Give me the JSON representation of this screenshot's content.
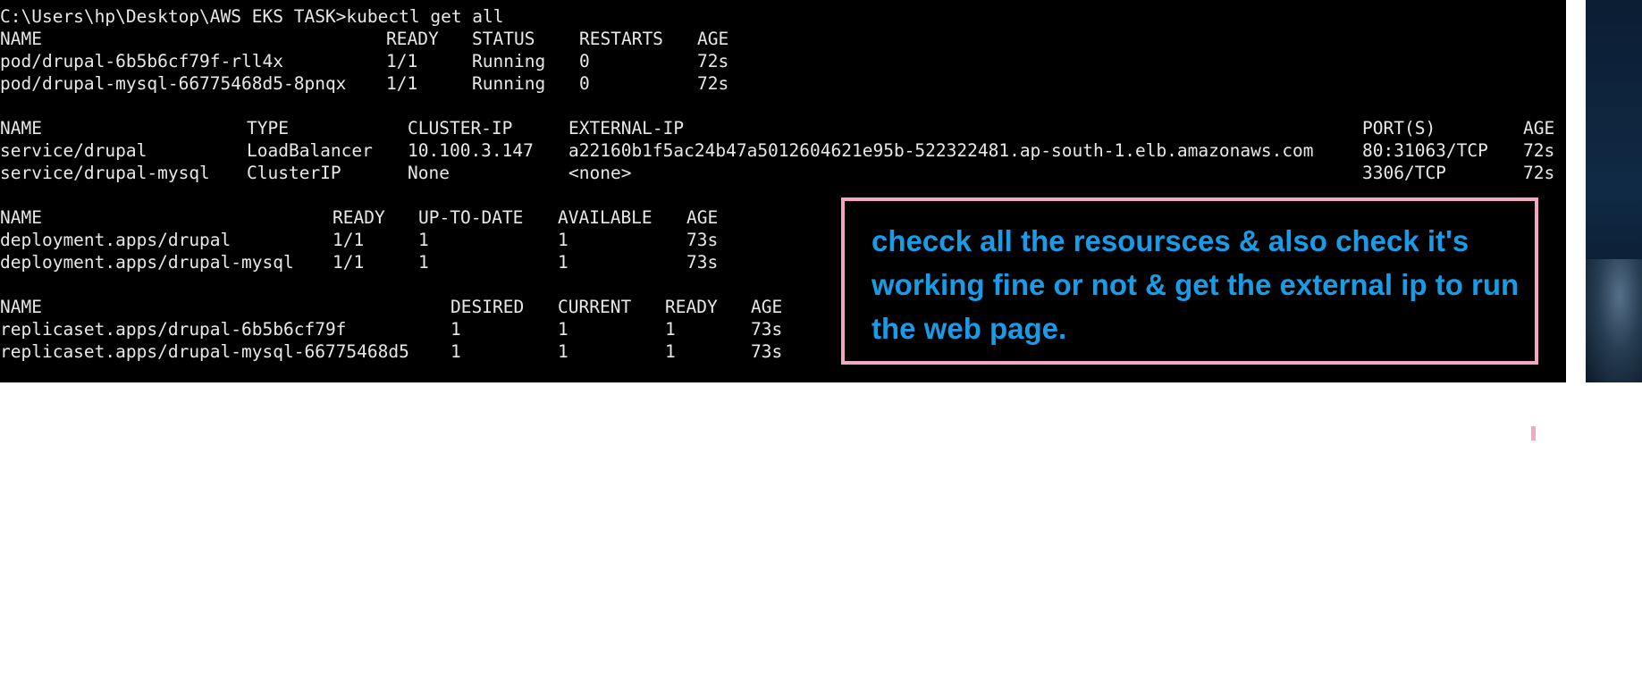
{
  "terminal": {
    "prompt": "C:\\Users\\hp\\Desktop\\AWS EKS TASK>kubectl get all",
    "pods": {
      "headers": [
        "NAME",
        "READY",
        "STATUS",
        "RESTARTS",
        "AGE"
      ],
      "rows": [
        [
          "pod/drupal-6b5b6cf79f-rll4x",
          "1/1",
          "Running",
          "0",
          "72s"
        ],
        [
          "pod/drupal-mysql-66775468d5-8pnqx",
          "1/1",
          "Running",
          "0",
          "72s"
        ]
      ]
    },
    "services": {
      "headers": [
        "NAME",
        "TYPE",
        "CLUSTER-IP",
        "EXTERNAL-IP",
        "PORT(S)",
        "AGE"
      ],
      "rows": [
        [
          "service/drupal",
          "LoadBalancer",
          "10.100.3.147",
          "a22160b1f5ac24b47a5012604621e95b-522322481.ap-south-1.elb.amazonaws.com",
          "80:31063/TCP",
          "72s"
        ],
        [
          "service/drupal-mysql",
          "ClusterIP",
          "None",
          "<none>",
          "3306/TCP",
          "72s"
        ]
      ]
    },
    "deployments": {
      "headers": [
        "NAME",
        "READY",
        "UP-TO-DATE",
        "AVAILABLE",
        "AGE"
      ],
      "rows": [
        [
          "deployment.apps/drupal",
          "1/1",
          "1",
          "1",
          "73s"
        ],
        [
          "deployment.apps/drupal-mysql",
          "1/1",
          "1",
          "1",
          "73s"
        ]
      ]
    },
    "replicasets": {
      "headers": [
        "NAME",
        "DESIRED",
        "CURRENT",
        "READY",
        "AGE"
      ],
      "rows": [
        [
          "replicaset.apps/drupal-6b5b6cf79f",
          "1",
          "1",
          "1",
          "73s"
        ],
        [
          "replicaset.apps/drupal-mysql-66775468d5",
          "1",
          "1",
          "1",
          "73s"
        ]
      ]
    }
  },
  "annotation": {
    "text": "checck all the resoursces & also check it's working fine or not & get the external ip to run the web page.",
    "color": "#1a9be6",
    "border_color": "#f4a6c4"
  }
}
